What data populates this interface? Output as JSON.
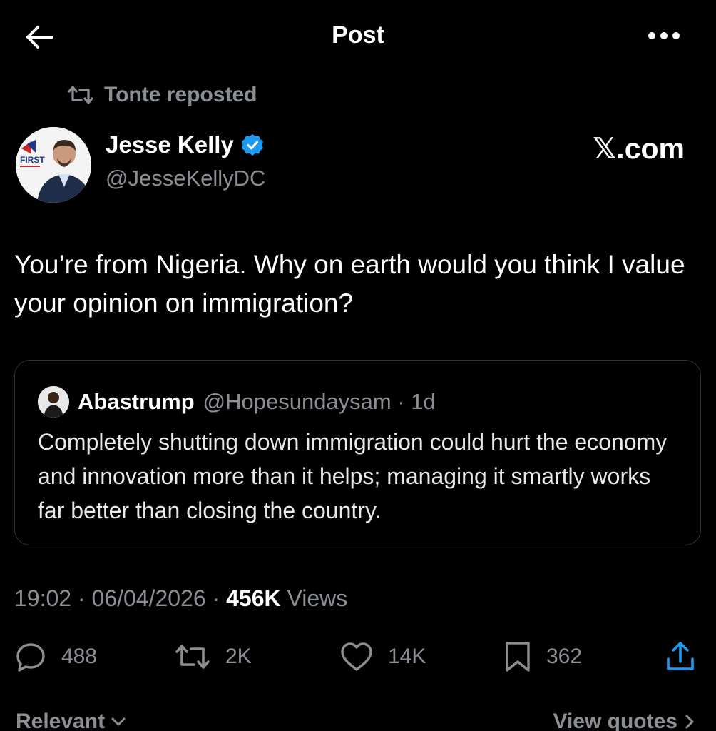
{
  "header": {
    "title": "Post"
  },
  "repost": {
    "label": "Tonte reposted"
  },
  "author": {
    "name": "Jesse Kelly",
    "handle": "@JesseKellyDC",
    "verified_color": "#1d9bf0",
    "avatar_logo_text": "FIRST"
  },
  "source_label": "𝕏.com",
  "post": {
    "text": "You’re from Nigeria. Why on earth would you think I value your opinion on immigration?"
  },
  "quote": {
    "name": "Abastrump",
    "meta": "@Hopesundaysam · 1d",
    "text": "Completely shutting down immigration could hurt the economy and innovation more than it helps; managing it smartly works far better than closing the country."
  },
  "timestamp": {
    "time_date": "19:02 · 06/04/2026 · ",
    "views_count": "456K",
    "views_label": " Views"
  },
  "actions": {
    "replies": "488",
    "reposts": "2K",
    "likes": "14K",
    "bookmarks": "362"
  },
  "footer": {
    "sort_label": "Relevant",
    "view_quotes_label": "View quotes"
  },
  "colors": {
    "background": "#000000",
    "muted": "#8b8f94",
    "border": "#2f3336"
  }
}
